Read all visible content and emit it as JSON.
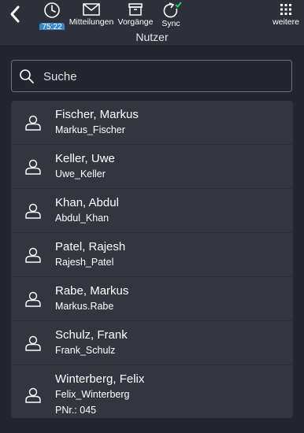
{
  "toolbar": {
    "timer_badge": "75:22",
    "messages_label": "Mitteilungen",
    "processes_label": "Vorgänge",
    "sync_label": "Sync",
    "more_label": "weitere"
  },
  "page": {
    "title": "Nutzer"
  },
  "search": {
    "placeholder": "Suche"
  },
  "users": [
    {
      "name": "Fischer, Markus",
      "login": "Markus_Fischer"
    },
    {
      "name": "Keller, Uwe",
      "login": "Uwe_Keller"
    },
    {
      "name": "Khan, Abdul",
      "login": "Abdul_Khan"
    },
    {
      "name": "Patel, Rajesh",
      "login": "Rajesh_Patel"
    },
    {
      "name": "Rabe, Markus",
      "login": "Markus.Rabe"
    },
    {
      "name": "Schulz, Frank",
      "login": "Frank_Schulz"
    },
    {
      "name": "Winterberg, Felix",
      "login": "Felix_Winterberg",
      "pnr": "PNr.: 045"
    }
  ],
  "colors": {
    "accent": "#3a86c8",
    "sync_ok": "#2ecc71",
    "background": "#23262e",
    "card": "#33363f"
  },
  "icons": [
    "chevron-left-icon",
    "clock-icon",
    "envelope-icon",
    "archive-box-icon",
    "sync-icon",
    "checkmark-icon",
    "grid-icon",
    "search-icon",
    "user-icon"
  ]
}
